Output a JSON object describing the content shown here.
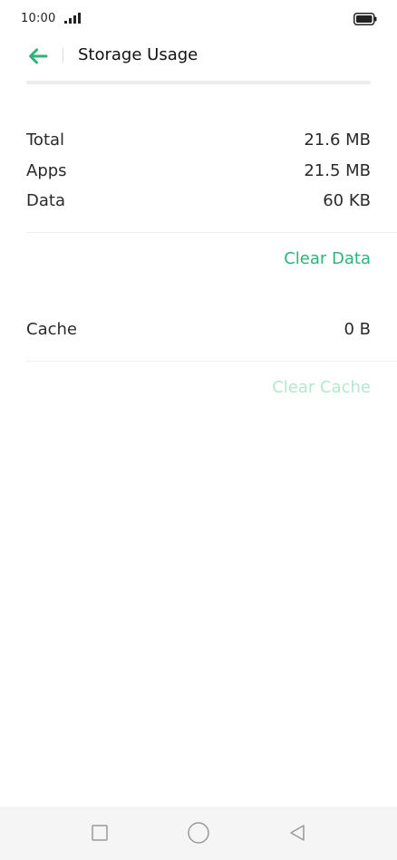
{
  "status_bar": {
    "time": "10:00"
  },
  "header": {
    "title": "Storage Usage",
    "back_icon": "back-arrow-icon",
    "accent_color": "#2db37a"
  },
  "storage": {
    "rows": [
      {
        "label": "Total",
        "value": "21.6 MB"
      },
      {
        "label": "Apps",
        "value": "21.5 MB"
      },
      {
        "label": "Data",
        "value": "60 KB"
      }
    ],
    "clear_data_label": "Clear Data"
  },
  "cache": {
    "label": "Cache",
    "value": "0 B",
    "clear_cache_label": "Clear Cache",
    "clear_cache_enabled": false
  },
  "nav_bar": {
    "items": [
      "recents-square-icon",
      "home-circle-icon",
      "back-triangle-icon"
    ]
  }
}
